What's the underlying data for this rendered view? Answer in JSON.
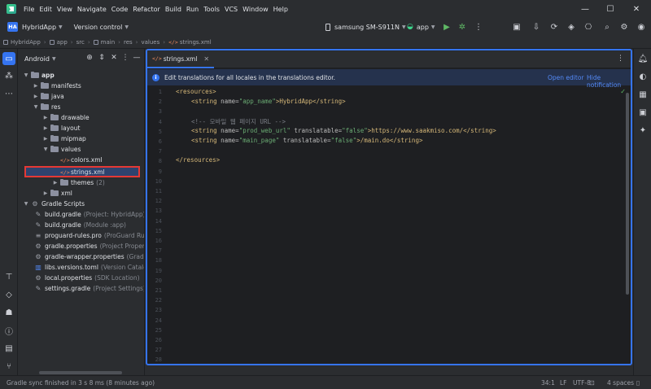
{
  "menu": [
    "File",
    "Edit",
    "View",
    "Navigate",
    "Code",
    "Refactor",
    "Build",
    "Run",
    "Tools",
    "VCS",
    "Window",
    "Help"
  ],
  "toolbar": {
    "project_badge": "HA",
    "project_name": "HybridApp",
    "version_control": "Version control",
    "device": "samsung SM-S911N",
    "run_config": "app"
  },
  "breadcrumb": [
    "HybridApp",
    "app",
    "src",
    "main",
    "res",
    "values",
    "strings.xml"
  ],
  "panel": {
    "title": "Android",
    "tree": [
      {
        "label": "app",
        "hint": ""
      },
      {
        "label": "manifests",
        "hint": ""
      },
      {
        "label": "java",
        "hint": ""
      },
      {
        "label": "res",
        "hint": ""
      },
      {
        "label": "drawable",
        "hint": ""
      },
      {
        "label": "layout",
        "hint": ""
      },
      {
        "label": "mipmap",
        "hint": ""
      },
      {
        "label": "values",
        "hint": ""
      },
      {
        "label": "colors.xml",
        "hint": ""
      },
      {
        "label": "strings.xml",
        "hint": ""
      },
      {
        "label": "themes",
        "hint": "(2)"
      },
      {
        "label": "xml",
        "hint": ""
      },
      {
        "label": "Gradle Scripts",
        "hint": ""
      },
      {
        "label": "build.gradle",
        "hint": "(Project: HybridApp)"
      },
      {
        "label": "build.gradle",
        "hint": "(Module :app)"
      },
      {
        "label": "proguard-rules.pro",
        "hint": "(ProGuard Rules for"
      },
      {
        "label": "gradle.properties",
        "hint": "(Project Properties)"
      },
      {
        "label": "gradle-wrapper.properties",
        "hint": "(Gradle Versio"
      },
      {
        "label": "libs.versions.toml",
        "hint": "(Version Catalog)"
      },
      {
        "label": "local.properties",
        "hint": "(SDK Location)"
      },
      {
        "label": "settings.gradle",
        "hint": "(Project Settings)"
      }
    ]
  },
  "editor": {
    "tab_label": "strings.xml",
    "notice": "Edit translations for all locales in the translations editor.",
    "open_editor": "Open editor",
    "hide_notification": "Hide notification",
    "line_numbers": [
      "1",
      "2",
      "3",
      "4",
      "5",
      "6",
      "7",
      "8",
      "9",
      "10",
      "11",
      "12",
      "13",
      "14",
      "15",
      "16",
      "17",
      "18",
      "19",
      "20",
      "21",
      "22",
      "23",
      "24",
      "25",
      "26",
      "27",
      "28"
    ],
    "code": {
      "l1_tag": "<resources>",
      "l2_open": "<string ",
      "l2_attr": "name=",
      "l2_val": "\"app_name\"",
      "l2_text": ">HybridApp</string>",
      "l4_comment": "<!-- 모바일 웹 페이지 URL -->",
      "l5_open": "<string ",
      "l5_attr1": "name=",
      "l5_val1": "\"prod_web_url\"",
      "l5_attr2": " translatable=",
      "l5_val2": "\"false\"",
      "l5_text": ">https://www.saakmiso.com/</string>",
      "l6_open": "<string ",
      "l6_attr1": "name=",
      "l6_val1": "\"main_page\"",
      "l6_attr2": " translatable=",
      "l6_val2": "\"false\"",
      "l6_text": ">/main.do</string>",
      "l8_tag": "</resources>"
    }
  },
  "status": {
    "message": "Gradle sync finished in 3 s 8 ms (8 minutes ago)",
    "position": "34:1",
    "line_sep": "LF",
    "encoding": "UTF-8",
    "indent": "4 spaces"
  },
  "colors": {
    "accent": "#3574f0",
    "highlight": "#e53935",
    "bg": "#1e1f22",
    "panel": "#2b2d30"
  }
}
